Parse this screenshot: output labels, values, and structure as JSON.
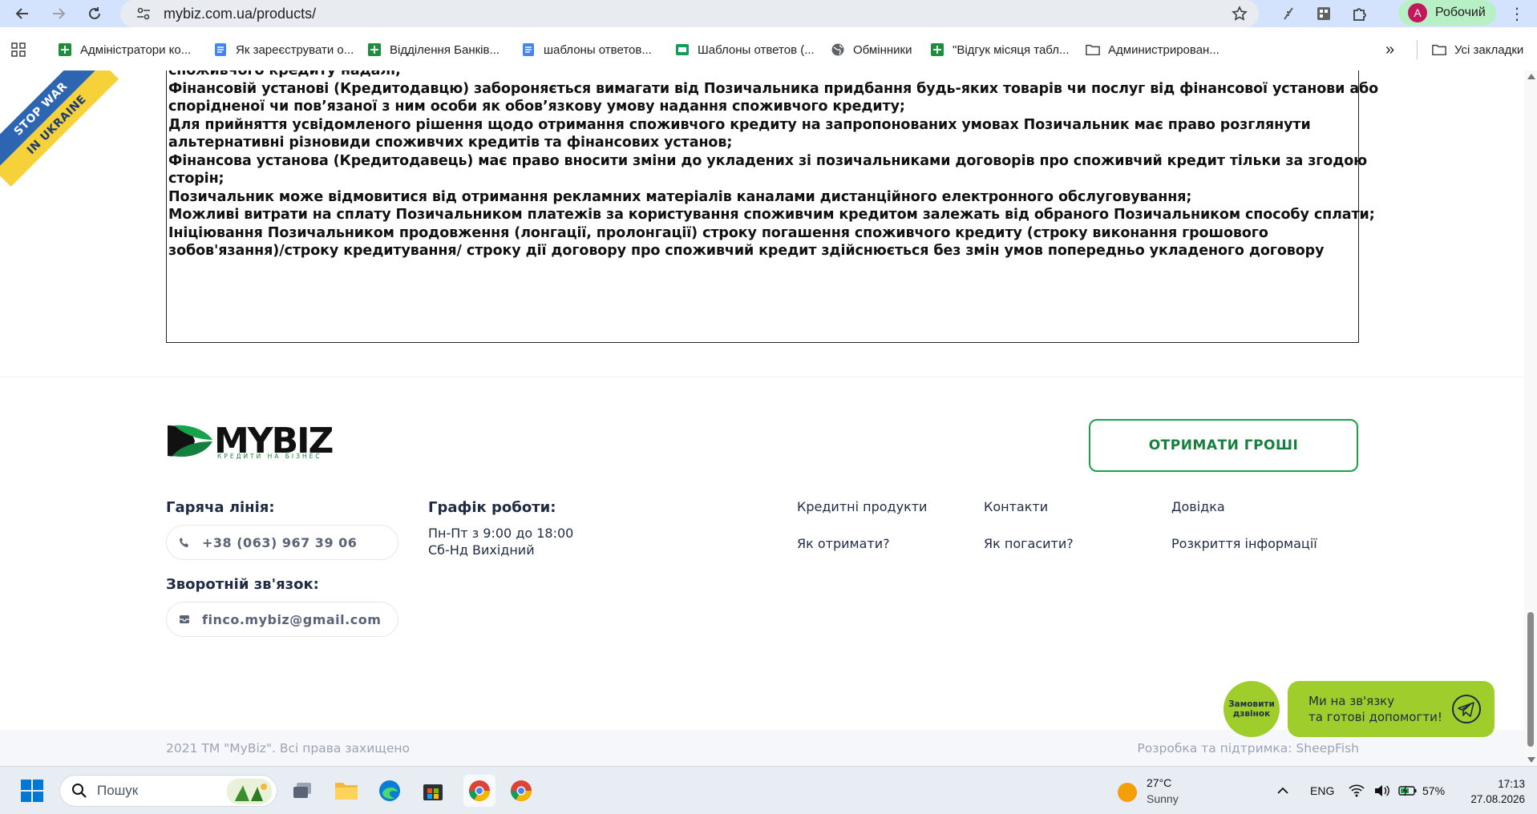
{
  "browser": {
    "url": "mybiz.com.ua/products/",
    "profile_name": "Робочий",
    "profile_initial": "A",
    "bookmarks": [
      {
        "label": "Адміністратори ко..."
      },
      {
        "label": "Як зареєструвати о..."
      },
      {
        "label": "Відділення Банків..."
      },
      {
        "label": "шаблоны ответов..."
      },
      {
        "label": "Шаблоны ответов (..."
      },
      {
        "label": "Обмінники"
      },
      {
        "label": "\"Відгук місяця табл..."
      },
      {
        "label": "Администрирован..."
      }
    ],
    "all_bookmarks": "Усі закладки",
    "more_bookmarks": "»"
  },
  "banner": {
    "line1": "STOP WAR",
    "line2": "IN UKRAINE"
  },
  "terms": {
    "lines": [
      "споживчого кредиту надалі;",
      "Фінансовій установі (Кредитодавцю) забороняється вимагати від Позичальника придбання будь-яких товарів чи послуг від фінансової установи або",
      "спорідненої чи пов’язаної з ним особи як обов’язкову умову надання споживчого кредиту;",
      "Для прийняття усвідомленого рішення щодо отримання споживчого кредиту на запропонованих умовах Позичальник має право розглянути",
      "альтернативні різновиди споживчих кредитів та фінансових установ;",
      "Фінансова установа (Кредитодавець) має право вносити зміни до укладених зі позичальниками договорів про споживчий кредит тільки за згодою",
      "сторін;",
      "Позичальник може відмовитися від отримання рекламних матеріалів каналами дистанційного електронного обслуговування;",
      "Можливі витрати на сплату Позичальником платежів за користування споживчим кредитом залежать від обраного Позичальником способу сплати;",
      "Ініціювання Позичальником продовження (лонгації, пролонгації) строку погашення           споживчого кредиту (строку виконання грошового",
      "зобов'язання)/строку кредитування/      строку дії договору про споживчий кредит здійснюється без змін умов  попередньо укладеного договору"
    ]
  },
  "footer": {
    "logo_word": "MYBIZ",
    "logo_sub": "КРЕДИТИ НА БІЗНЕС",
    "cta": "ОТРИМАТИ ГРОШІ",
    "hotline_title": "Гаряча лінія:",
    "phone": "+38 (063) 967 39 06",
    "feedback_title": "Зворотній зв'язок:",
    "email": "finco.mybiz@gmail.com",
    "schedule_title": "Графік роботи:",
    "schedule_line1": "Пн-Пт з 9:00 до 18:00",
    "schedule_line2": "Сб-Нд Вихідний",
    "links": {
      "credit_products": "Кредитні продукти",
      "contacts": "Контакти",
      "help": "Довідка",
      "how_to_get": "Як отримати?",
      "how_to_repay": "Як погасити?",
      "disclosure": "Розкриття інформації"
    },
    "copyright": "2021 ТМ \"MyBiz\". Всі права захищено",
    "developer": "Розробка та підтримка: SheepFish"
  },
  "widgets": {
    "callback_line1": "Замовити",
    "callback_line2": "дзвінок",
    "chat_line1": "Ми на зв'язку",
    "chat_line2": "та готові допомогти!"
  },
  "taskbar": {
    "search_placeholder": "Пошук",
    "temperature": "27°C",
    "weather": "Sunny",
    "language": "ENG",
    "battery": "57%",
    "time": "17:13",
    "date": "27.08.2026"
  },
  "colors": {
    "brand_green": "#16a34a",
    "widget_green": "#9fcd2b",
    "chrome_blue": "#d3e3fd"
  }
}
